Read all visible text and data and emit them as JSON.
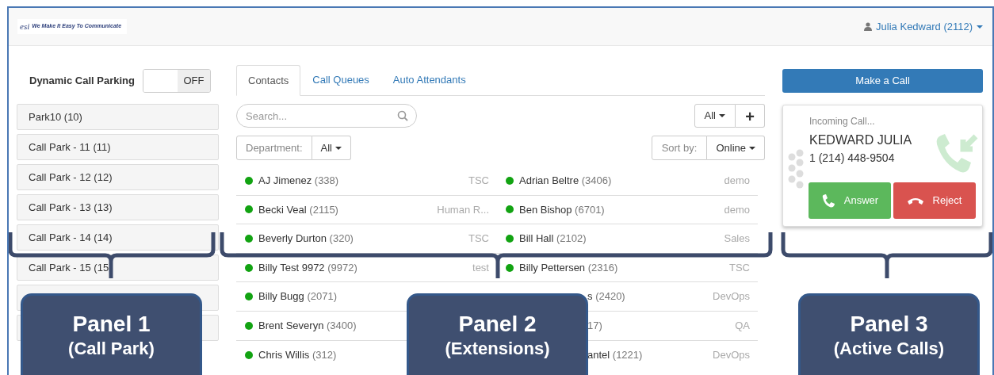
{
  "header": {
    "logo_mark": "esi",
    "logo_tagline": "We Make It Easy To Communicate",
    "user": "Julia Kedward (2112)"
  },
  "call_park": {
    "label": "Dynamic Call Parking",
    "toggle": {
      "label": "OFF",
      "on": false
    },
    "items": [
      {
        "label": "Park10 (10)"
      },
      {
        "label": "Call Park - 11 (11)"
      },
      {
        "label": "Call Park - 12 (12)"
      },
      {
        "label": "Call Park - 13 (13)"
      },
      {
        "label": "Call Park - 14 (14)"
      },
      {
        "label": "Call Park - 15 (15"
      },
      {
        "kind": "covered"
      },
      {
        "kind": "covered"
      }
    ]
  },
  "tabs": [
    {
      "label": "Contacts",
      "selected": true
    },
    {
      "label": "Call Queues",
      "selected": false
    },
    {
      "label": "Auto Attendants",
      "selected": false
    }
  ],
  "search": {
    "placeholder": "Search..."
  },
  "filter": {
    "label": "All"
  },
  "add_button": "+",
  "department": {
    "label": "Department:",
    "value": "All"
  },
  "sort": {
    "label": "Sort by:",
    "value": "Online"
  },
  "contact_columns": [
    [
      {
        "kind": "full",
        "name": "AJ Jimenez",
        "ext": "(338)",
        "dept": "TSC"
      },
      {
        "kind": "full",
        "name": "Becki Veal",
        "ext": "(2115)",
        "dept": "Human R..."
      },
      {
        "kind": "full",
        "name": "Beverly Durton",
        "ext": "(320)",
        "dept": "TSC"
      },
      {
        "kind": "full",
        "name": "Billy Test 9972",
        "ext": "(9972)",
        "dept": "test"
      },
      {
        "kind": "full",
        "name": "Billy Bugg",
        "ext": "(2071)"
      },
      {
        "kind": "full",
        "name": "Brent Severyn",
        "ext": "(3400)"
      },
      {
        "kind": "full",
        "name": "Chris Willis",
        "ext": "(312)"
      }
    ],
    [
      {
        "kind": "full",
        "name": "Adrian Beltre",
        "ext": "(3406)",
        "dept": "demo"
      },
      {
        "kind": "full",
        "name": "Ben Bishop",
        "ext": "(6701)",
        "dept": "demo"
      },
      {
        "kind": "full",
        "name": "Bill Hall",
        "ext": "(2102)",
        "dept": "Sales"
      },
      {
        "kind": "full",
        "name": "Billy Pettersen",
        "ext": "(2316)",
        "dept": "TSC"
      },
      {
        "kind": "partial",
        "name": "s",
        "ext": "(2420)",
        "dept": "DevOps"
      },
      {
        "kind": "partial",
        "ext": "17)",
        "dept": "QA"
      },
      {
        "kind": "partial",
        "name": "antel",
        "ext": "(1221)",
        "dept": "DevOps"
      }
    ]
  ],
  "make_call": "Make a Call",
  "incoming": {
    "status": "Incoming Call...",
    "caller": "KEDWARD JULIA",
    "number": "1 (214) 448-9504",
    "answer": "Answer",
    "reject": "Reject"
  },
  "callouts": [
    {
      "title": "Panel 1",
      "subtitle": "(Call Park)"
    },
    {
      "title": "Panel 2",
      "subtitle": "(Extensions)"
    },
    {
      "title": "Panel 3",
      "subtitle": "(Active Calls)"
    }
  ]
}
